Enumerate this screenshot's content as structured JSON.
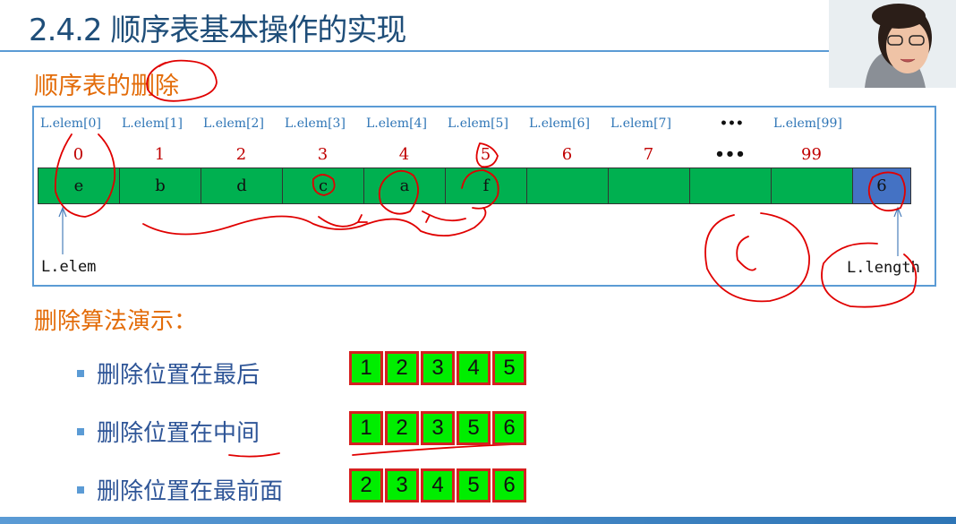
{
  "title": "2.4.2 顺序表基本操作的实现",
  "section1": "顺序表的删除",
  "headers": [
    "L.elem[0]",
    "L.elem[1]",
    "L.elem[2]",
    "L.elem[3]",
    "L.elem[4]",
    "L.elem[5]",
    "L.elem[6]",
    "L.elem[7]",
    "•••",
    "L.elem[99]"
  ],
  "indices": [
    "0",
    "1",
    "2",
    "3",
    "4",
    "5",
    "6",
    "7",
    "•••",
    "99"
  ],
  "cells": [
    "e",
    "b",
    "d",
    "c",
    "a",
    "f",
    "",
    "",
    "",
    "",
    "6"
  ],
  "pointer_left": "L.elem",
  "pointer_right": "L.length",
  "section2": "删除算法演示：",
  "demos": [
    {
      "label": "删除位置在最后",
      "values": [
        "1",
        "2",
        "3",
        "4",
        "5"
      ]
    },
    {
      "label": "删除位置在中间",
      "values": [
        "1",
        "2",
        "3",
        "5",
        "6"
      ]
    },
    {
      "label": "删除位置在最前面",
      "values": [
        "2",
        "3",
        "4",
        "5",
        "6"
      ]
    }
  ],
  "colors": {
    "title": "#1f4e79",
    "section": "#e36c09",
    "cell": "#00b050",
    "length_cell": "#4472c4",
    "index": "#c00000",
    "annotation": "#e00000"
  }
}
